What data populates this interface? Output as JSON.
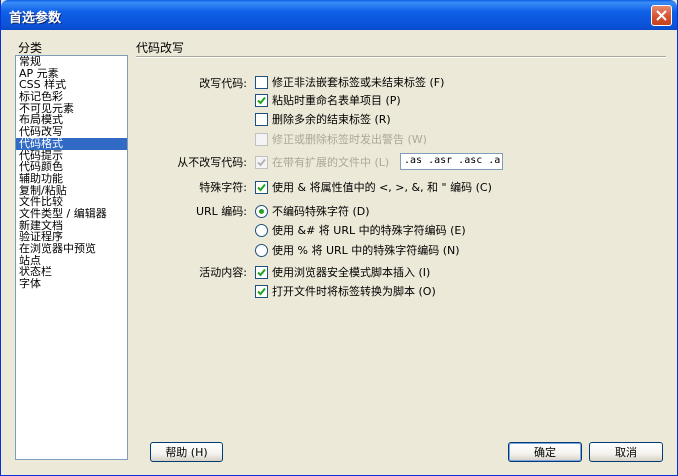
{
  "window": {
    "title": "首选参数"
  },
  "sidebar": {
    "label": "分类",
    "items": [
      "常规",
      "AP 元素",
      "CSS 样式",
      "标记色彩",
      "不可见元素",
      "布局模式",
      "代码改写",
      "代码格式",
      "代码提示",
      "代码颜色",
      "辅助功能",
      "复制/粘贴",
      "文件比较",
      "文件类型 / 编辑器",
      "新建文档",
      "验证程序",
      "在浏览器中预览",
      "站点",
      "状态栏",
      "字体"
    ],
    "selected_index": 7
  },
  "main": {
    "title": "代码改写",
    "rewrite": {
      "label": "改写代码:",
      "opt1": "修正非法嵌套标签或未结束标签 (F)",
      "opt2": "粘贴时重命名表单项目 (P)",
      "opt3": "删除多余的结束标签 (R)",
      "opt4": "修正或删除标签时发出警告 (W)"
    },
    "no_rewrite": {
      "label": "从不改写代码:",
      "opt": "在带有扩展的文件中 (L)",
      "extensions": ".as .asr .asc .a"
    },
    "special": {
      "label": "特殊字符:",
      "opt": "使用 & 将属性值中的 <, >, &, 和 \" 编码 (C)"
    },
    "url": {
      "label": "URL 编码:",
      "opt1": "不编码特殊字符 (D)",
      "opt2": "使用 &# 将 URL 中的特殊字符编码 (E)",
      "opt3": "使用 % 将 URL 中的特殊字符编码 (N)"
    },
    "active": {
      "label": "活动内容:",
      "opt1": "使用浏览器安全模式脚本插入 (I)",
      "opt2": "打开文件时将标签转换为脚本 (O)"
    }
  },
  "footer": {
    "help": "帮助 (H)",
    "ok": "确定",
    "cancel": "取消"
  }
}
